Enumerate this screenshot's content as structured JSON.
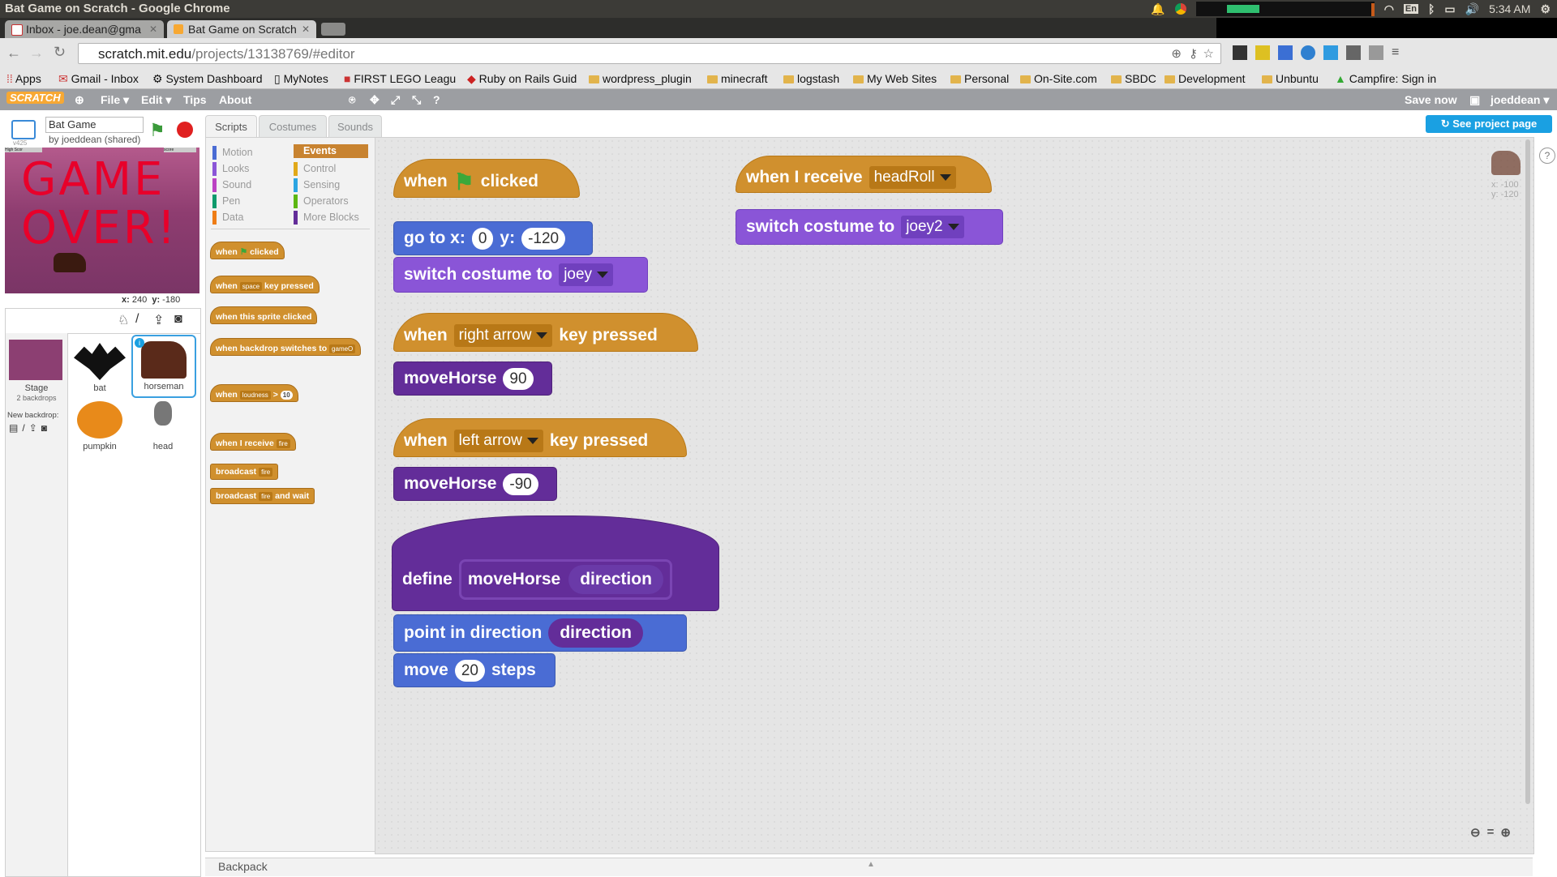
{
  "window": {
    "title": "Bat Game on Scratch - Google Chrome",
    "time": "5:34 AM",
    "lang": "En"
  },
  "tabs": [
    {
      "label": "Inbox - joe.dean@gma",
      "active": false
    },
    {
      "label": "Bat Game on Scratch",
      "active": true
    }
  ],
  "address": {
    "domain": "scratch.mit.edu",
    "path": "/projects/13138769/#editor"
  },
  "bookmarks": [
    "Apps",
    "Gmail - Inbox",
    "System Dashboard",
    "MyNotes",
    "FIRST LEGO Leagu",
    "Ruby on Rails Guid",
    "wordpress_plugin",
    "minecraft",
    "logstash",
    "My Web Sites",
    "Personal",
    "On-Site.com",
    "SBDC",
    "Development",
    "Unbuntu",
    "Campfire: Sign in"
  ],
  "scratch_menu": {
    "logo": "SCRATCH",
    "file": "File",
    "edit": "Edit",
    "tips": "Tips",
    "about": "About",
    "save": "Save now",
    "user": "joeddean",
    "see_project": "See project page"
  },
  "project": {
    "name": "Bat Game",
    "by": "by joeddean (shared)",
    "version": "v425",
    "stage_text": "GAME OVER!",
    "high_score": "High Scor",
    "score": "score",
    "coords_x": "240",
    "coords_y": "-180",
    "x_label": "x:",
    "y_label": "y:"
  },
  "editor_tabs": [
    "Scripts",
    "Costumes",
    "Sounds"
  ],
  "categories": {
    "left": [
      {
        "name": "Motion",
        "color": "#4a6cd4"
      },
      {
        "name": "Looks",
        "color": "#8a55d7"
      },
      {
        "name": "Sound",
        "color": "#bb42c3"
      },
      {
        "name": "Pen",
        "color": "#0e9a6c"
      },
      {
        "name": "Data",
        "color": "#ee7d16"
      }
    ],
    "right": [
      {
        "name": "Events",
        "color": "#c88330"
      },
      {
        "name": "Control",
        "color": "#e1a91a"
      },
      {
        "name": "Sensing",
        "color": "#2ca5e2"
      },
      {
        "name": "Operators",
        "color": "#5cb712"
      },
      {
        "name": "More Blocks",
        "color": "#632d99"
      }
    ]
  },
  "palette": {
    "when": "when",
    "clicked": "clicked",
    "space": "space",
    "key_pressed": "key pressed",
    "sprite_clicked": "when this sprite clicked",
    "backdrop_switches": "when backdrop switches to",
    "backdrop_val": "gameO",
    "loudness": "loudness",
    "gt": ">",
    "ten": "10",
    "when_receive": "when I receive",
    "fire": "fire",
    "broadcast": "broadcast",
    "and_wait": "and wait"
  },
  "scripts": {
    "green_flag": {
      "when": "when",
      "clicked": "clicked",
      "goto": "go to x:",
      "x": "0",
      "y_label": "y:",
      "y": "-120",
      "switch": "switch costume to",
      "costume": "joey"
    },
    "right": {
      "when": "when",
      "key": "right arrow",
      "pressed": "key pressed",
      "call": "moveHorse",
      "arg": "90"
    },
    "left": {
      "when": "when",
      "key": "left arrow",
      "pressed": "key pressed",
      "call": "moveHorse",
      "arg": "-90"
    },
    "define": {
      "define": "define",
      "name": "moveHorse",
      "param": "direction",
      "point": "point in direction",
      "param_ref": "direction",
      "move": "move",
      "steps_val": "20",
      "steps": "steps"
    },
    "receive": {
      "when": "when I receive",
      "msg": "headRoll",
      "switch": "switch costume to",
      "costume": "joey2"
    }
  },
  "sprite_info": {
    "x": "x: -100",
    "y": "y: -120"
  },
  "sprites": {
    "stage_label": "Stage",
    "backdrops": "2 backdrops",
    "new_backdrop": "New backdrop:",
    "items": [
      "bat",
      "horseman",
      "pumpkin",
      "head"
    ]
  },
  "backpack": "Backpack"
}
